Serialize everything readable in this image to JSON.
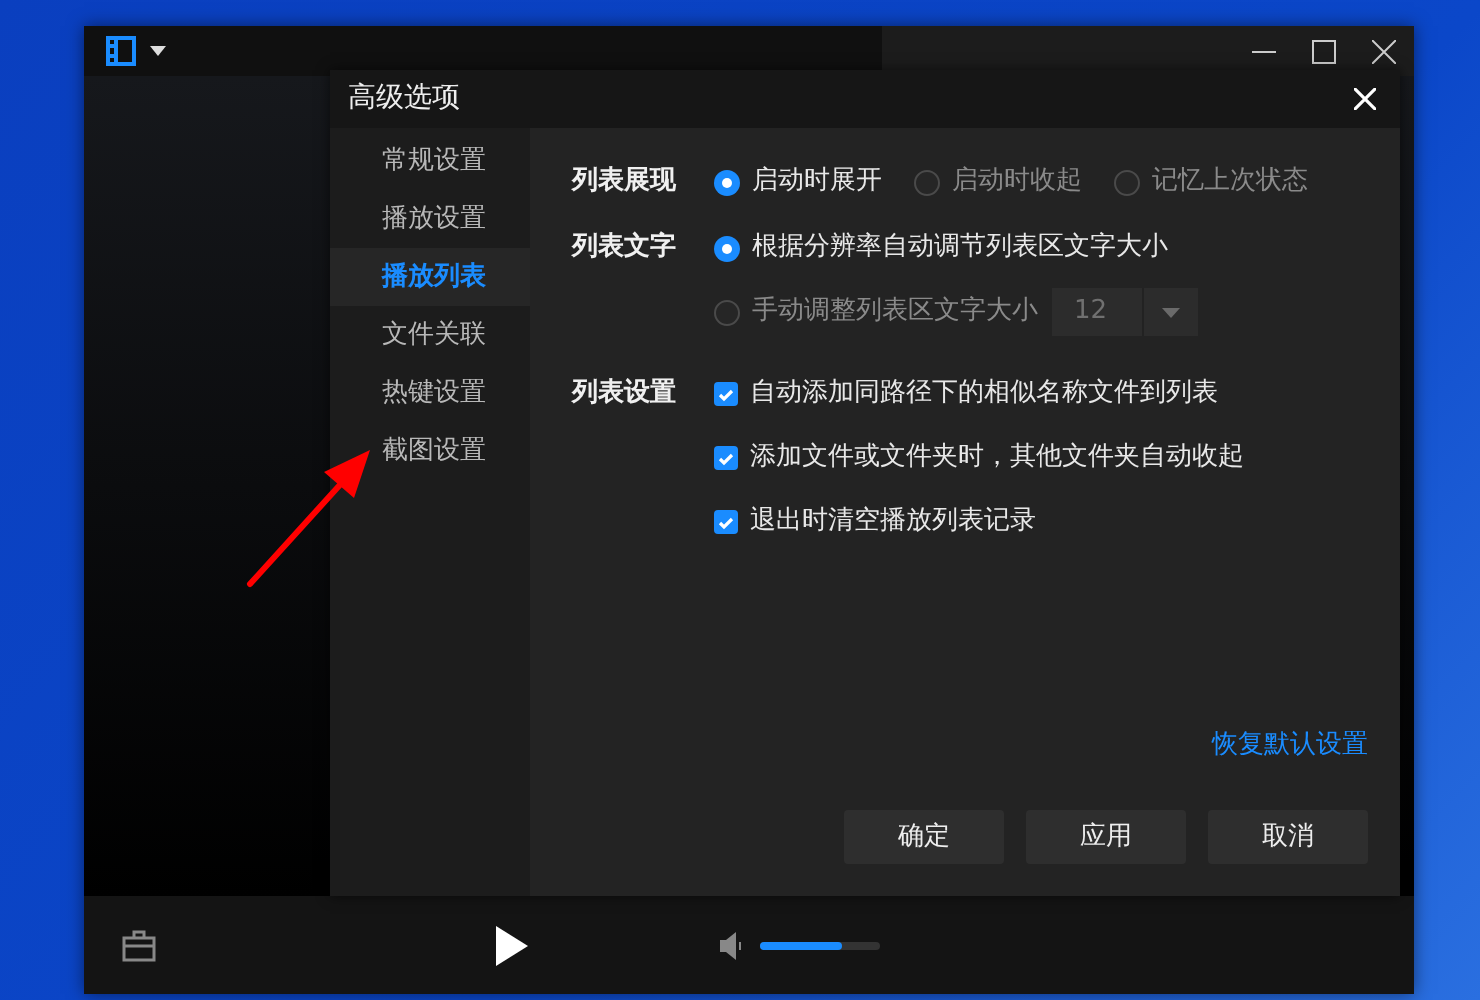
{
  "player": {
    "volume": {
      "level": 0.68
    }
  },
  "dialog": {
    "title": "高级选项",
    "nav": [
      {
        "label": "常规设置",
        "selected": false
      },
      {
        "label": "播放设置",
        "selected": false
      },
      {
        "label": "播放列表",
        "selected": true
      },
      {
        "label": "文件关联",
        "selected": false
      },
      {
        "label": "热键设置",
        "selected": false
      },
      {
        "label": "截图设置",
        "selected": false
      }
    ],
    "sections": [
      {
        "label": "列表展现",
        "rows": [
          {
            "kind": "radios",
            "options": [
              {
                "label": "启动时展开",
                "selected": true
              },
              {
                "label": "启动时收起",
                "selected": false
              },
              {
                "label": "记忆上次状态",
                "selected": false
              }
            ]
          }
        ]
      },
      {
        "label": "列表文字",
        "rows": [
          {
            "kind": "radio",
            "label": "根据分辨率自动调节列表区文字大小",
            "selected": true
          },
          {
            "kind": "radio",
            "label": "手动调整列表区文字大小",
            "selected": false,
            "dropdown": {
              "value": "12",
              "disabled": true
            }
          }
        ]
      },
      {
        "label": "列表设置",
        "rows": [
          {
            "kind": "checkbox",
            "label": "自动添加同路径下的相似名称文件到列表",
            "checked": true
          },
          {
            "kind": "checkbox",
            "label": "添加文件或文件夹时，其他文件夹自动收起",
            "checked": true
          },
          {
            "kind": "checkbox",
            "label": "退出时清空播放列表记录",
            "checked": true
          }
        ]
      }
    ],
    "reset_link": "恢复默认设置",
    "buttons": [
      "确定",
      "应用",
      "取消"
    ]
  }
}
